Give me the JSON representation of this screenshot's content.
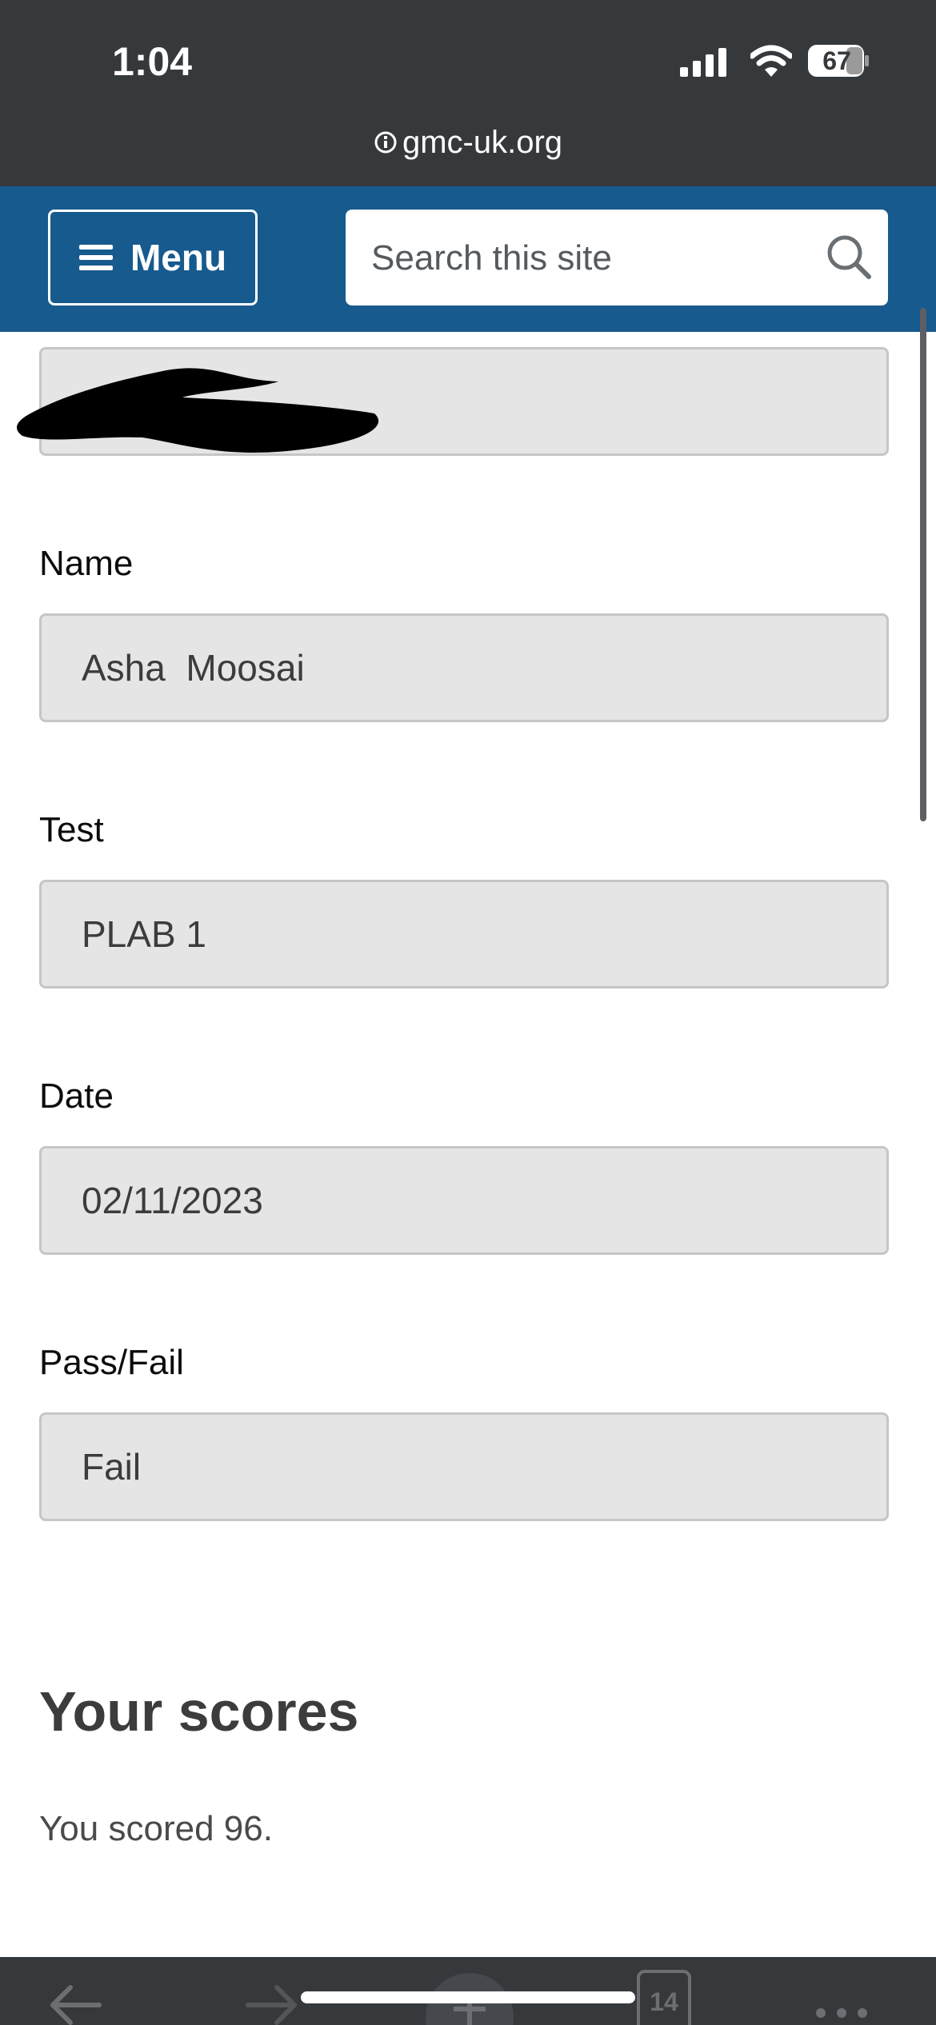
{
  "status_bar": {
    "time": "1:04",
    "battery": "67"
  },
  "browser": {
    "url": "gmc-uk.org",
    "tabs_count": "14"
  },
  "header": {
    "menu_label": "Menu",
    "search_placeholder": "Search this site"
  },
  "form": {
    "fields": [
      {
        "label": "Name",
        "value": "Asha  Moosai"
      },
      {
        "label": "Test",
        "value": "PLAB 1"
      },
      {
        "label": "Date",
        "value": "02/11/2023"
      },
      {
        "label": "Pass/Fail",
        "value": "Fail"
      }
    ]
  },
  "scores": {
    "heading": "Your scores",
    "text": "You scored 96."
  },
  "colors": {
    "header_blue": "#175a8e",
    "chrome_dark": "#36393c",
    "field_bg": "#e5e5e5"
  }
}
